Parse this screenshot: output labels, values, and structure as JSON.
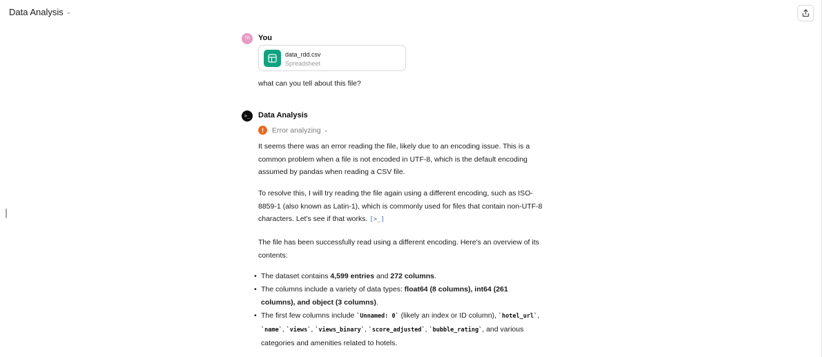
{
  "header": {
    "title": "Data Analysis",
    "share_icon": "share-icon"
  },
  "user_message": {
    "avatar_initials": "TR",
    "role": "You",
    "file": {
      "name": "data_rdd.csv",
      "type": "Spreadsheet",
      "icon": "spreadsheet-icon",
      "color": "#10a37f"
    },
    "text": "what can you tell about this file?"
  },
  "assistant": {
    "avatar": ">_",
    "role": "Data Analysis",
    "error_label": "Error analyzing",
    "error_color": "#e86a24",
    "para1": "It seems there was an error reading the file, likely due to an encoding issue. This is a common problem when a file is not encoded in UTF-8, which is the default encoding assumed by pandas when reading a CSV file.",
    "para2": "To resolve this, I will try reading the file again using a different encoding, such as ISO-8859-1 (also known as Latin-1), which is commonly used for files that contain non-UTF-8 characters. Let's see if that works.",
    "code_link": "[>_]",
    "para3": "The file has been successfully read using a different encoding. Here's an overview of its contents:",
    "bullets": {
      "b1_pre": "The dataset contains ",
      "b1_entries": "4,599 entries",
      "b1_mid": " and ",
      "b1_cols": "272 columns",
      "b1_end": ".",
      "b2_pre": "The columns include a variety of data types: ",
      "b2_types": "float64 (8 columns), int64 (261 columns), and object (3 columns)",
      "b2_end": ".",
      "b3_pre": "The first few columns include ",
      "b3_c1": "`Unnamed: 0`",
      "b3_mid1": " (likely an index or ID column), ",
      "b3_c2": "`hotel_url`",
      "b3_c3": "`name`",
      "b3_c4": "`views`",
      "b3_c5": "`views_binary`",
      "b3_c6": "`score_adjusted`",
      "b3_c7": "`bubble_rating`",
      "b3_end": ", and various categories and amenities related to hotels.",
      "sep": ", "
    }
  }
}
